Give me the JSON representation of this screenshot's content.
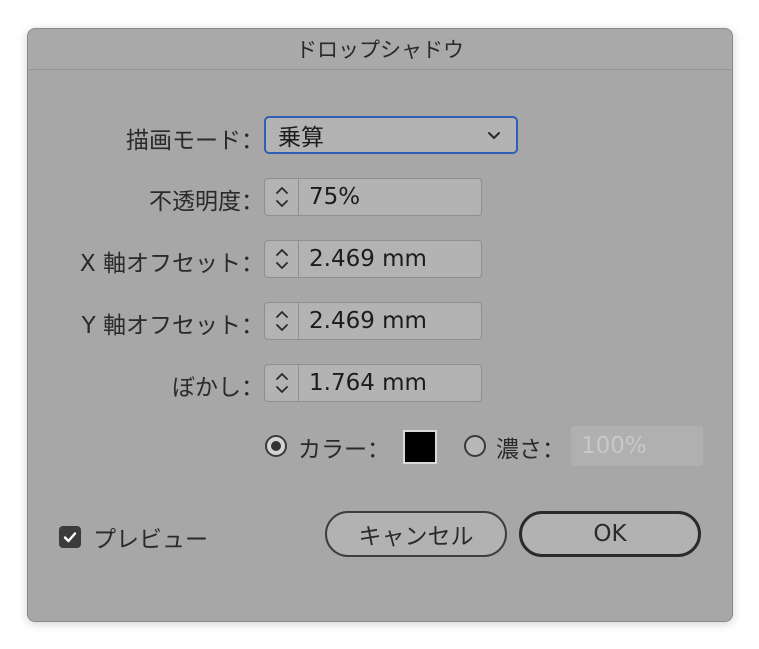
{
  "dialog": {
    "title": "ドロップシャドウ"
  },
  "fields": {
    "mode_label": "描画モード：",
    "mode_value": "乗算",
    "opacity_label": "不透明度：",
    "opacity_value": "75%",
    "x_offset_label": "X 軸オフセット：",
    "x_offset_value": "2.469 mm",
    "y_offset_label": "Y 軸オフセット：",
    "y_offset_value": "2.469 mm",
    "blur_label": "ぼかし：",
    "blur_value": "1.764 mm"
  },
  "color_options": {
    "color_label": "カラー：",
    "color_selected": true,
    "swatch_color": "#000000",
    "density_label": "濃さ：",
    "density_selected": false,
    "density_value": "100%"
  },
  "preview": {
    "label": "プレビュー",
    "checked": true
  },
  "buttons": {
    "cancel": "キャンセル",
    "ok": "OK"
  },
  "icons": {
    "select": "chevron-down-icon",
    "stepper": "up-down-arrows-icon",
    "checkbox": "checkmark-icon"
  }
}
